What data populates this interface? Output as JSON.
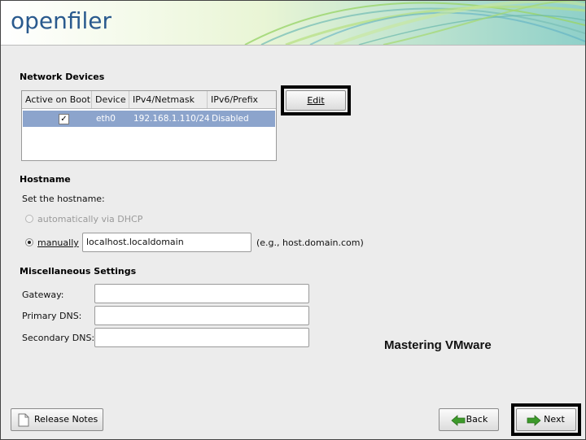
{
  "banner": {
    "logo": "openfiler"
  },
  "network": {
    "title": "Network Devices",
    "columns": [
      "Active on Boot",
      "Device",
      "IPv4/Netmask",
      "IPv6/Prefix"
    ],
    "rows": [
      {
        "active": "✓",
        "device": "eth0",
        "ipv4": "192.168.1.110/24",
        "ipv6": "Disabled"
      }
    ],
    "edit_label": "Edit"
  },
  "hostname": {
    "title": "Hostname",
    "prompt": "Set the hostname:",
    "dhcp_label": "automatically via DHCP",
    "manual_label": "manually",
    "value": "localhost.localdomain",
    "hint": "(e.g., host.domain.com)"
  },
  "misc": {
    "title": "Miscellaneous Settings",
    "gateway_label": "Gateway:",
    "gateway_value": "",
    "primary_dns_label": "Primary DNS:",
    "primary_dns_value": "",
    "secondary_dns_label": "Secondary DNS:",
    "secondary_dns_value": ""
  },
  "watermark": "Mastering VMware",
  "footer": {
    "release_notes_label": "Release Notes",
    "back_label": "Back",
    "next_label": "Next"
  },
  "colors": {
    "selection": "#8ca4cc",
    "logo": "#2a5a8e",
    "arrow_green": "#3c9a2a"
  },
  "icons": [
    "document-icon",
    "back-arrow-icon",
    "next-arrow-icon",
    "checkbox-checked-icon"
  ]
}
